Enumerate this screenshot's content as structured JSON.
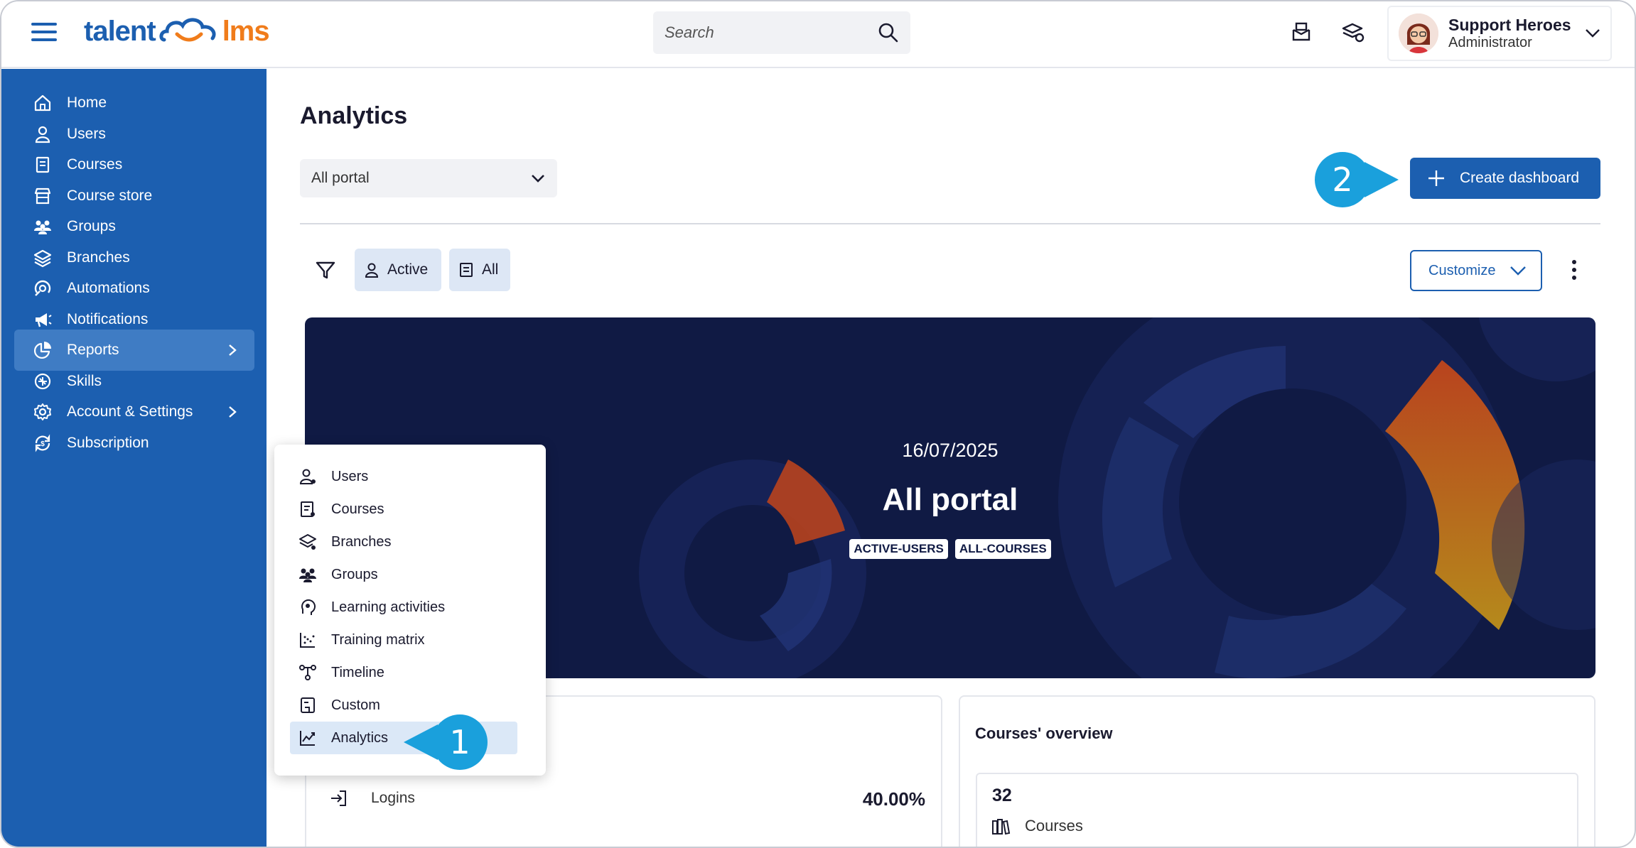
{
  "header": {
    "logo_left": "talent",
    "logo_right": "lms",
    "search_placeholder": "Search",
    "user": {
      "name": "Support Heroes",
      "role": "Administrator"
    }
  },
  "sidebar": {
    "items": [
      {
        "label": "Home",
        "icon": "home-icon"
      },
      {
        "label": "Users",
        "icon": "user-icon"
      },
      {
        "label": "Courses",
        "icon": "book-icon"
      },
      {
        "label": "Course store",
        "icon": "store-icon"
      },
      {
        "label": "Groups",
        "icon": "groups-icon"
      },
      {
        "label": "Branches",
        "icon": "layers-icon"
      },
      {
        "label": "Automations",
        "icon": "automation-icon"
      },
      {
        "label": "Notifications",
        "icon": "megaphone-icon"
      },
      {
        "label": "Reports",
        "icon": "pie-chart-icon",
        "active": true,
        "submenu": true
      },
      {
        "label": "Skills",
        "icon": "skills-icon"
      },
      {
        "label": "Account & Settings",
        "icon": "gear-icon",
        "submenu": true
      },
      {
        "label": "Subscription",
        "icon": "subscription-icon"
      }
    ]
  },
  "reports_menu": {
    "items": [
      {
        "label": "Users",
        "icon": "user-report-icon"
      },
      {
        "label": "Courses",
        "icon": "course-report-icon"
      },
      {
        "label": "Branches",
        "icon": "branches-report-icon"
      },
      {
        "label": "Groups",
        "icon": "groups-report-icon"
      },
      {
        "label": "Learning activities",
        "icon": "learning-activities-icon"
      },
      {
        "label": "Training matrix",
        "icon": "training-matrix-icon"
      },
      {
        "label": "Timeline",
        "icon": "timeline-icon"
      },
      {
        "label": "Custom",
        "icon": "custom-report-icon"
      },
      {
        "label": "Analytics",
        "icon": "analytics-icon",
        "selected": true
      }
    ]
  },
  "main": {
    "title": "Analytics",
    "portal_select": "All portal",
    "create_button": "Create dashboard",
    "chips": {
      "active": "Active",
      "all": "All"
    },
    "customize_button": "Customize",
    "banner": {
      "date": "16/07/2025",
      "title": "All portal",
      "tags": [
        "ACTIVE-USERS",
        "ALL-COURSES"
      ]
    },
    "logins": {
      "label": "Logins",
      "value": "40.00%"
    },
    "courses_overview": {
      "title": "Courses' overview",
      "count": "32",
      "label": "Courses"
    }
  },
  "callouts": {
    "one": "1",
    "two": "2"
  },
  "colors": {
    "brand_blue": "#1c5fb0",
    "brand_orange": "#f07c1b",
    "callout": "#1aa0dc",
    "banner_bg": "#101a44"
  }
}
